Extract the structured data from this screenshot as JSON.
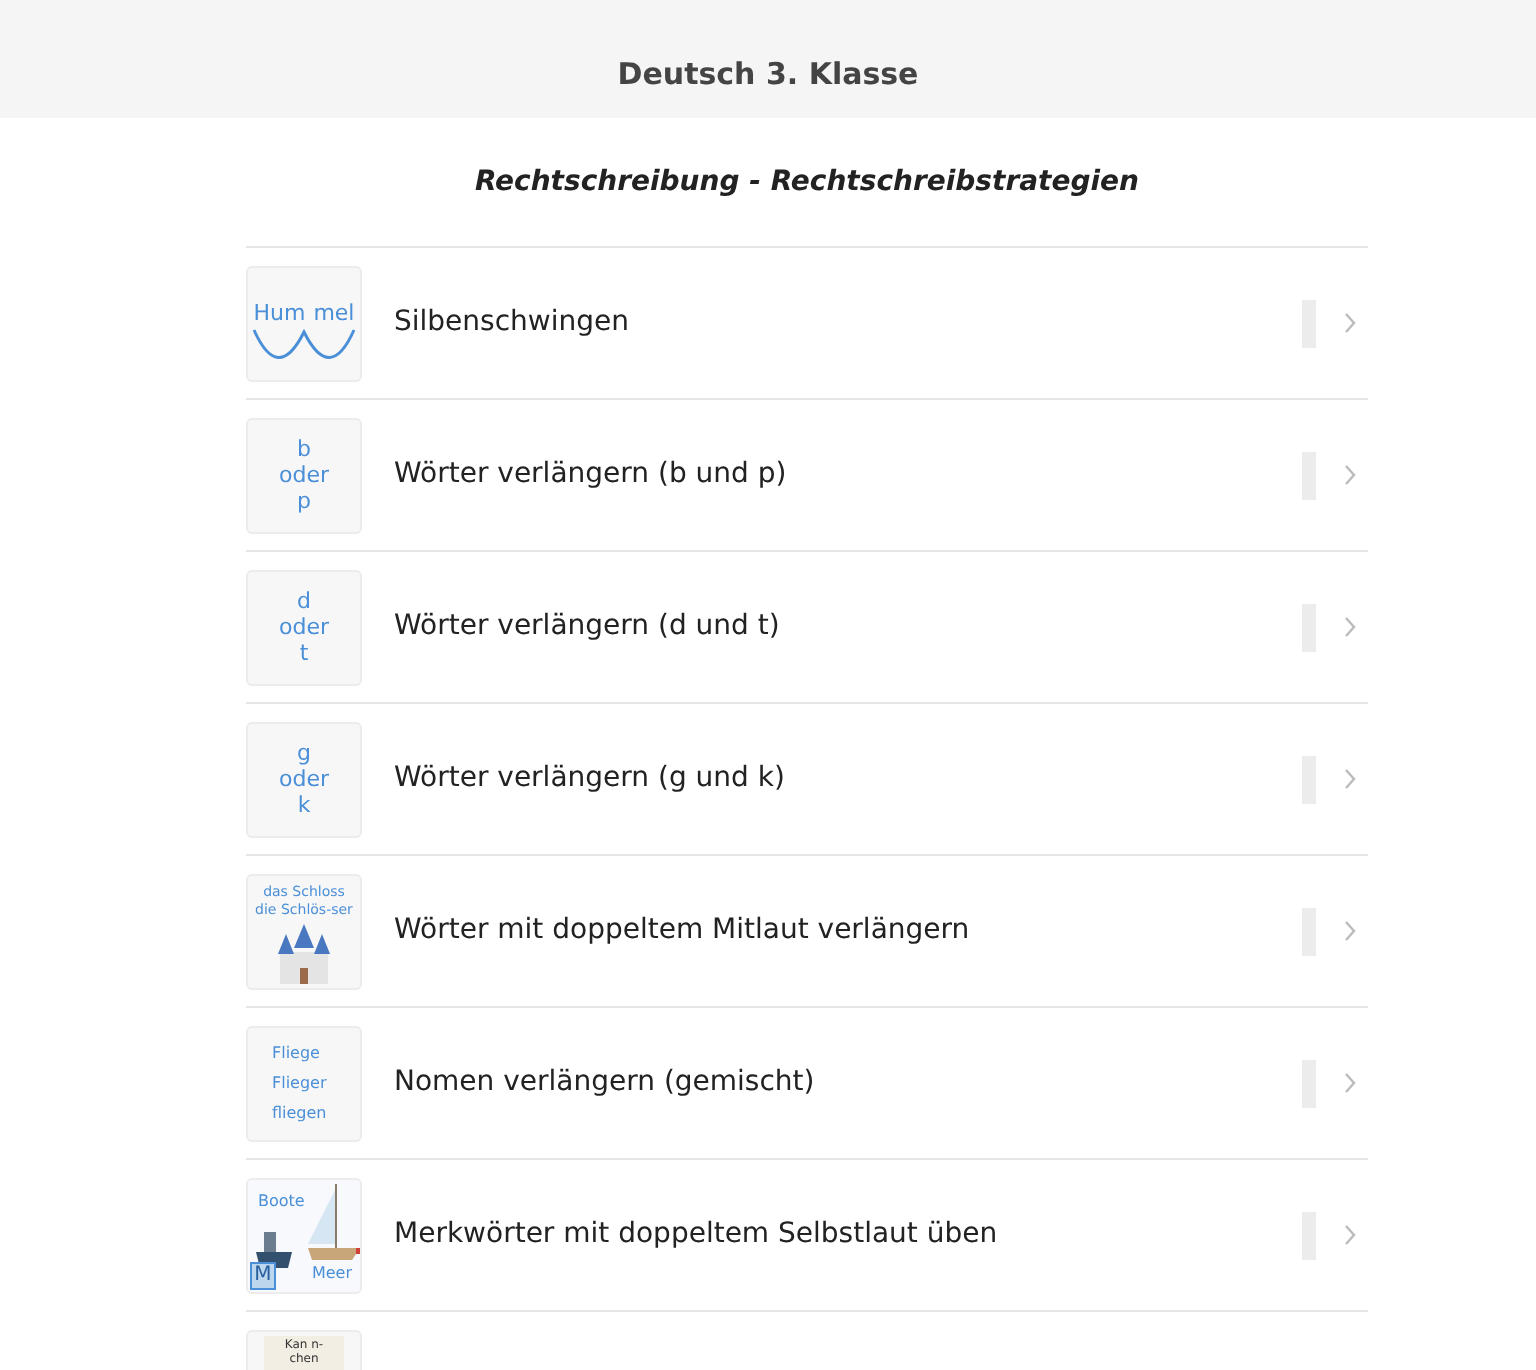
{
  "header": {
    "title": "Deutsch 3. Klasse"
  },
  "section": {
    "title": "Rechtschreibung - Rechtschreibstrategien"
  },
  "rows": [
    {
      "title": "Silbenschwingen",
      "thumb": {
        "kind": "syllables",
        "lines": [
          "Hum",
          "mel"
        ]
      }
    },
    {
      "title": "Wörter verlängern (b und p)",
      "thumb": {
        "kind": "stack",
        "lines": [
          "b",
          "oder",
          "p"
        ]
      }
    },
    {
      "title": "Wörter verlängern (d und t)",
      "thumb": {
        "kind": "stack",
        "lines": [
          "d",
          "oder",
          "t"
        ]
      }
    },
    {
      "title": "Wörter verlängern (g und k)",
      "thumb": {
        "kind": "stack",
        "lines": [
          "g",
          "oder",
          "k"
        ]
      }
    },
    {
      "title": "Wörter mit doppeltem Mitlaut verlängern",
      "thumb": {
        "kind": "castle",
        "lines": [
          "das Schloss",
          "die Schlös-ser"
        ]
      }
    },
    {
      "title": "Nomen verlängern (gemischt)",
      "thumb": {
        "kind": "words",
        "lines": [
          "Fliege",
          "Flieger",
          "fliegen"
        ]
      }
    },
    {
      "title": "Merkwörter mit doppeltem Selbstlaut üben",
      "thumb": {
        "kind": "boats",
        "lines": [
          "Boote",
          "M",
          "Meer"
        ]
      }
    },
    {
      "thumb": {
        "kind": "film",
        "lines": [
          "Kan n-",
          "chen"
        ]
      }
    }
  ]
}
